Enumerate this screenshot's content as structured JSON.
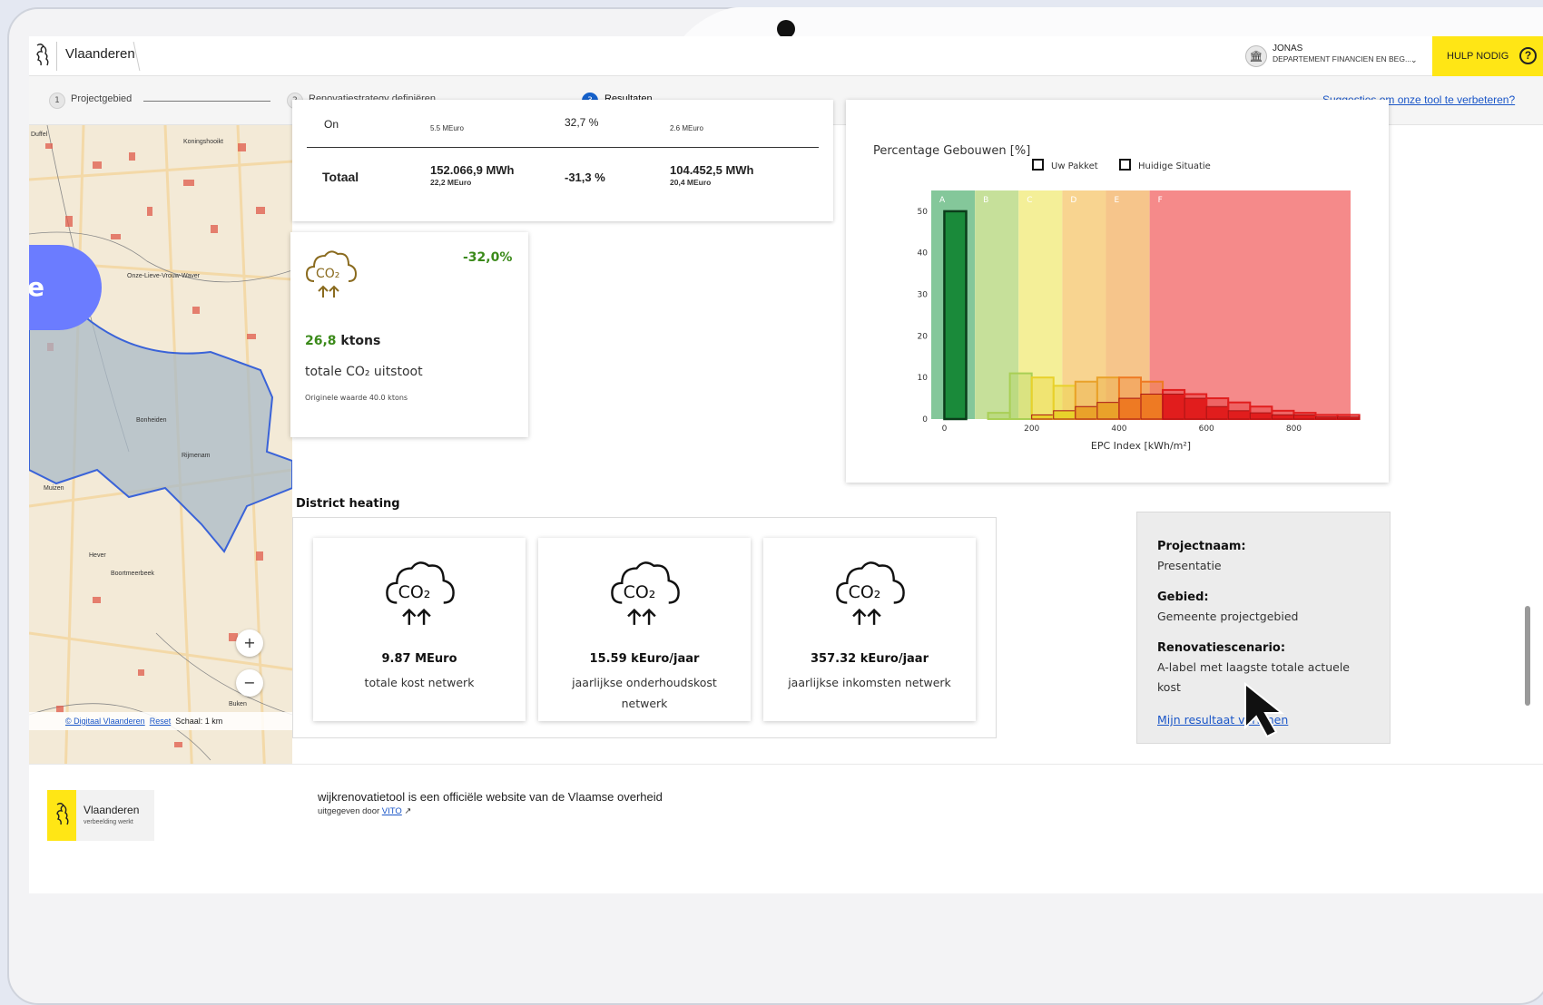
{
  "header": {
    "brand": "Vlaanderen",
    "user_name": "JONAS",
    "user_dept": "DEPARTEMENT FINANCIEN EN BEG...",
    "help_label": "HULP NODIG"
  },
  "stepper": {
    "steps": [
      {
        "num": "1",
        "label": "Projectgebied"
      },
      {
        "num": "2",
        "label": "Renovatiestrategy definiëren"
      },
      {
        "num": "3",
        "label": "Resultaten"
      }
    ],
    "suggest_link": "Suggesties om onze tool te verbeteren?"
  },
  "map": {
    "places": [
      "Duffel",
      "Koningshooikt",
      "Onze-Lieve-Vrouw-Waver",
      "Bonheiden",
      "Rijmenam",
      "Muizen",
      "Hever",
      "Boortmeerbeek",
      "Buken"
    ],
    "attribution": "© Digitaal Vlaanderen",
    "reset": "Reset",
    "scale": "Schaal: 1 km",
    "zoom_in": "+",
    "zoom_out": "−",
    "overlay_letter": "e"
  },
  "summary_table": {
    "partial_row": {
      "label": "On",
      "energy_sub": "5.5 MEuro",
      "pct": "32,7 %",
      "new_sub": "2.6 MEuro"
    },
    "total_row": {
      "label": "Totaal",
      "energy": "152.066,9 MWh",
      "energy_sub": "22,2 MEuro",
      "pct": "-31,3 %",
      "new_energy": "104.452,5 MWh",
      "new_sub": "20,4 MEuro"
    }
  },
  "co2_card": {
    "pct": "-32,0%",
    "value_num": "26,8",
    "value_unit": " ktons",
    "label": "totale CO₂ uitstoot",
    "original": "Originele waarde 40.0 ktons",
    "icon_text": "CO₂"
  },
  "chart_data": {
    "type": "bar",
    "title": "Percentage Gebouwen [%]",
    "xlabel": "EPC Index [kWh/m²]",
    "ylabel": "",
    "xlim": [
      -30,
      930
    ],
    "ylim": [
      0,
      55
    ],
    "xticks": [
      0,
      200,
      400,
      600,
      800
    ],
    "yticks": [
      0,
      10,
      20,
      30,
      40,
      50
    ],
    "legend": [
      "Uw Pakket",
      "Huidige Situatie"
    ],
    "legend_position": "top",
    "bands": [
      {
        "label": "A",
        "from": -30,
        "to": 70,
        "color": "#84c79a"
      },
      {
        "label": "B",
        "from": 70,
        "to": 170,
        "color": "#c6e09a"
      },
      {
        "label": "C",
        "from": 170,
        "to": 270,
        "color": "#f4ef98"
      },
      {
        "label": "D",
        "from": 270,
        "to": 370,
        "color": "#f8d490"
      },
      {
        "label": "E",
        "from": 370,
        "to": 470,
        "color": "#f6c58b"
      },
      {
        "label": "F",
        "from": 470,
        "to": 930,
        "color": "#f58a8a"
      }
    ],
    "bin_width": 50,
    "bins_x": [
      0,
      50,
      100,
      150,
      200,
      250,
      300,
      350,
      400,
      450,
      500,
      550,
      600,
      650,
      700,
      750,
      800,
      850,
      900
    ],
    "uw_pakket": [
      50,
      0,
      0,
      0,
      1,
      2,
      3,
      4,
      5,
      6,
      6,
      5,
      3,
      2,
      1.5,
      1,
      1,
      0.5,
      0.5
    ],
    "huidige_situatie": [
      0,
      0,
      1.5,
      11,
      10,
      8,
      9,
      10,
      10,
      9,
      7,
      6,
      5,
      4,
      3,
      2,
      1.5,
      1,
      1
    ]
  },
  "district_heating": {
    "title": "District heating",
    "cards": [
      {
        "value": "9.87 MEuro",
        "label": "totale kost netwerk"
      },
      {
        "value": "15.59 kEuro/jaar",
        "label": "jaarlijkse onderhoudskost netwerk"
      },
      {
        "value": "357.32 kEuro/jaar",
        "label": "jaarlijkse inkomsten netwerk"
      }
    ]
  },
  "project_info": {
    "name_label": "Projectnaam:",
    "name_value": "Presentatie",
    "area_label": "Gebied:",
    "area_value": "Gemeente projectgebied",
    "scenario_label": "Renovatiescenario:",
    "scenario_value": "A-label met laagste totale actuele kost",
    "refine_link": "Mijn resultaat verfijnen"
  },
  "footer": {
    "logo_name": "Vlaanderen",
    "logo_sub": "verbeelding werkt",
    "text": "wijkrenovatietool is een officiële website van de Vlaamse overheid",
    "published_by": "uitgegeven door ",
    "vito_link": "VITO"
  },
  "colors": {
    "accent_blue": "#1560c9",
    "brand_yellow": "#ffe615",
    "positive_green": "#3b8a1a",
    "overlay_purple": "#6b7cff"
  }
}
